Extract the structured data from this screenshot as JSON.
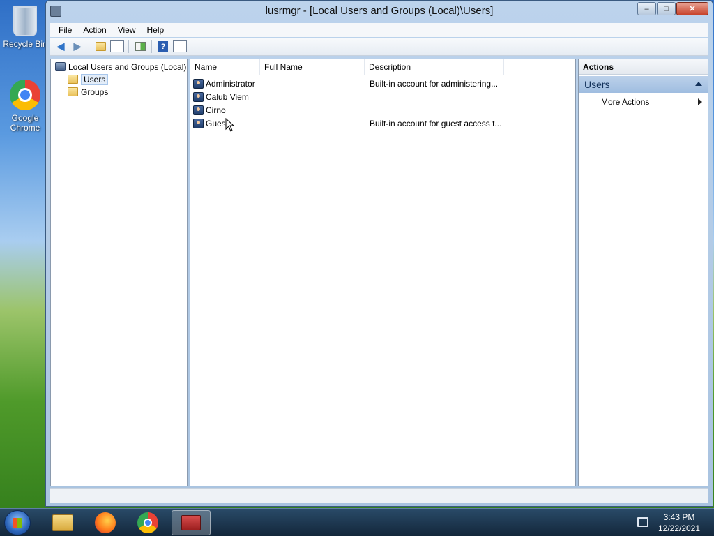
{
  "desktop": {
    "icons": [
      {
        "label": "Recycle Bin"
      },
      {
        "label": "Google Chrome"
      }
    ]
  },
  "window": {
    "title": "lusrmgr - [Local Users and Groups (Local)\\Users]",
    "controls": {
      "minimize": "–",
      "maximize": "□",
      "close": "✕"
    }
  },
  "menu": [
    "File",
    "Action",
    "View",
    "Help"
  ],
  "tree": {
    "root": "Local Users and Groups (Local)",
    "items": [
      {
        "label": "Users",
        "selected": true
      },
      {
        "label": "Groups",
        "selected": false
      }
    ]
  },
  "list": {
    "columns": [
      "Name",
      "Full Name",
      "Description"
    ],
    "rows": [
      {
        "name": "Administrator",
        "full_name": "",
        "description": "Built-in account for administering..."
      },
      {
        "name": "Calub Viem",
        "full_name": "",
        "description": ""
      },
      {
        "name": "Cirno",
        "full_name": "",
        "description": ""
      },
      {
        "name": "Guest",
        "full_name": "",
        "description": "Built-in account for guest access t..."
      }
    ]
  },
  "actions": {
    "header": "Actions",
    "section": "Users",
    "items": [
      "More Actions"
    ]
  },
  "taskbar": {
    "time": "3:43 PM",
    "date": "12/22/2021"
  }
}
